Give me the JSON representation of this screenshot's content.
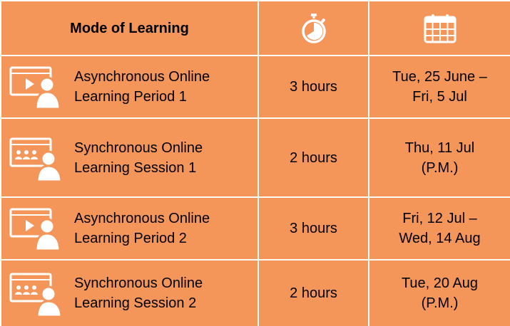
{
  "header": {
    "mode_title": "Mode of Learning",
    "duration_icon": "stopwatch-icon",
    "date_icon": "calendar-icon"
  },
  "rows": [
    {
      "icon": "async-video-learner-icon",
      "mode": "Asynchronous Online\nLearning Period 1",
      "duration": "3 hours",
      "dates": "Tue, 25 June –\nFri, 5 Jul"
    },
    {
      "icon": "sync-group-learner-icon",
      "mode": "Synchronous Online\nLearning Session 1",
      "duration": "2 hours",
      "dates": "Thu, 11 Jul\n(P.M.)"
    },
    {
      "icon": "async-video-learner-icon",
      "mode": "Asynchronous Online\nLearning Period 2",
      "duration": "3 hours",
      "dates": "Fri, 12 Jul –\nWed, 14 Aug"
    },
    {
      "icon": "sync-group-learner-icon",
      "mode": "Synchronous Online\nLearning Session 2",
      "duration": "2 hours",
      "dates": "Tue, 20 Aug\n(P.M.)"
    }
  ],
  "colors": {
    "cell_background": "#f4955a",
    "grid_lines": "#ffffff",
    "icon": "#ffffff"
  }
}
